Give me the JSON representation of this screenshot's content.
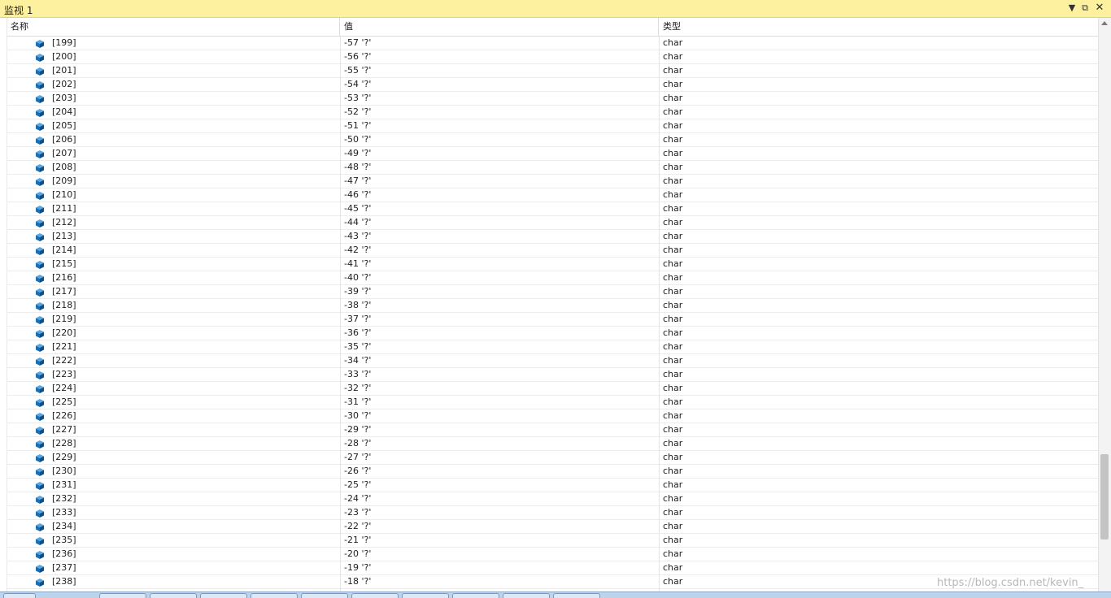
{
  "window": {
    "title": "监视 1",
    "buttons": {
      "dropdown": "▼",
      "float": "⧉",
      "close": "✕"
    }
  },
  "columns": {
    "name": "名称",
    "value": "值",
    "type": "类型"
  },
  "rows": [
    {
      "name": "[199]",
      "value": "-57 '?'",
      "type": "char"
    },
    {
      "name": "[200]",
      "value": "-56 '?'",
      "type": "char"
    },
    {
      "name": "[201]",
      "value": "-55 '?'",
      "type": "char"
    },
    {
      "name": "[202]",
      "value": "-54 '?'",
      "type": "char"
    },
    {
      "name": "[203]",
      "value": "-53 '?'",
      "type": "char"
    },
    {
      "name": "[204]",
      "value": "-52 '?'",
      "type": "char"
    },
    {
      "name": "[205]",
      "value": "-51 '?'",
      "type": "char"
    },
    {
      "name": "[206]",
      "value": "-50 '?'",
      "type": "char"
    },
    {
      "name": "[207]",
      "value": "-49 '?'",
      "type": "char"
    },
    {
      "name": "[208]",
      "value": "-48 '?'",
      "type": "char"
    },
    {
      "name": "[209]",
      "value": "-47 '?'",
      "type": "char"
    },
    {
      "name": "[210]",
      "value": "-46 '?'",
      "type": "char"
    },
    {
      "name": "[211]",
      "value": "-45 '?'",
      "type": "char"
    },
    {
      "name": "[212]",
      "value": "-44 '?'",
      "type": "char"
    },
    {
      "name": "[213]",
      "value": "-43 '?'",
      "type": "char"
    },
    {
      "name": "[214]",
      "value": "-42 '?'",
      "type": "char"
    },
    {
      "name": "[215]",
      "value": "-41 '?'",
      "type": "char"
    },
    {
      "name": "[216]",
      "value": "-40 '?'",
      "type": "char"
    },
    {
      "name": "[217]",
      "value": "-39 '?'",
      "type": "char"
    },
    {
      "name": "[218]",
      "value": "-38 '?'",
      "type": "char"
    },
    {
      "name": "[219]",
      "value": "-37 '?'",
      "type": "char"
    },
    {
      "name": "[220]",
      "value": "-36 '?'",
      "type": "char"
    },
    {
      "name": "[221]",
      "value": "-35 '?'",
      "type": "char"
    },
    {
      "name": "[222]",
      "value": "-34 '?'",
      "type": "char"
    },
    {
      "name": "[223]",
      "value": "-33 '?'",
      "type": "char"
    },
    {
      "name": "[224]",
      "value": "-32 '?'",
      "type": "char"
    },
    {
      "name": "[225]",
      "value": "-31 '?'",
      "type": "char"
    },
    {
      "name": "[226]",
      "value": "-30 '?'",
      "type": "char"
    },
    {
      "name": "[227]",
      "value": "-29 '?'",
      "type": "char"
    },
    {
      "name": "[228]",
      "value": "-28 '?'",
      "type": "char"
    },
    {
      "name": "[229]",
      "value": "-27 '?'",
      "type": "char"
    },
    {
      "name": "[230]",
      "value": "-26 '?'",
      "type": "char"
    },
    {
      "name": "[231]",
      "value": "-25 '?'",
      "type": "char"
    },
    {
      "name": "[232]",
      "value": "-24 '?'",
      "type": "char"
    },
    {
      "name": "[233]",
      "value": "-23 '?'",
      "type": "char"
    },
    {
      "name": "[234]",
      "value": "-22 '?'",
      "type": "char"
    },
    {
      "name": "[235]",
      "value": "-21 '?'",
      "type": "char"
    },
    {
      "name": "[236]",
      "value": "-20 '?'",
      "type": "char"
    },
    {
      "name": "[237]",
      "value": "-19 '?'",
      "type": "char"
    },
    {
      "name": "[238]",
      "value": "-18 '?'",
      "type": "char"
    }
  ],
  "icons": {
    "row": "variable-cube-icon"
  },
  "colors": {
    "titlebar": "#fdf09f",
    "icon_blue": "#1c6fb5",
    "icon_dark": "#0d4f8a"
  },
  "watermark": "https://blog.csdn.net/kevin_"
}
